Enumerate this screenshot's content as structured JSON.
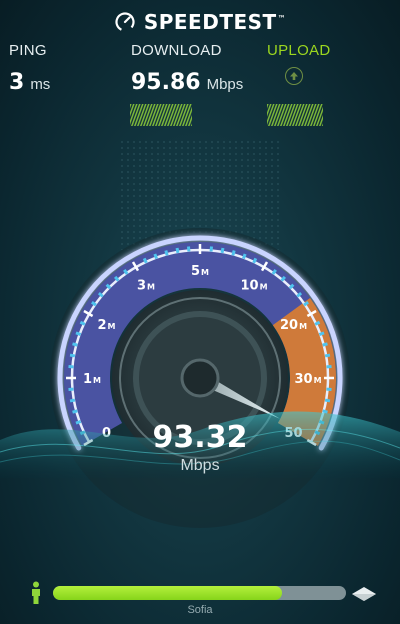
{
  "header": {
    "brand": "SPEEDTEST",
    "trademark": "™",
    "icon": "gauge-icon"
  },
  "ping": {
    "label": "PING",
    "value": "3",
    "unit": "ms"
  },
  "download": {
    "label": "DOWNLOAD",
    "value": "95.86",
    "unit": "Mbps"
  },
  "upload": {
    "label": "UPLOAD",
    "icon": "arrow-up-icon"
  },
  "gauge": {
    "current_value": "93.32",
    "current_unit": "Mbps",
    "ticks": [
      {
        "num": "0",
        "unit": ""
      },
      {
        "num": "1",
        "unit": "M"
      },
      {
        "num": "2",
        "unit": "M"
      },
      {
        "num": "3",
        "unit": "M"
      },
      {
        "num": "5",
        "unit": "M"
      },
      {
        "num": "10",
        "unit": "M"
      },
      {
        "num": "20",
        "unit": "M"
      },
      {
        "num": "30",
        "unit": "M"
      },
      {
        "num": "50",
        "unit": ""
      }
    ],
    "needle_tick_position": 8
  },
  "footer": {
    "server": "Sofia",
    "progress": 0.78,
    "left_icon": "person-icon",
    "right_icon": "server-icon"
  },
  "colors": {
    "accent_green": "#9bd61f",
    "gauge_blue": "#4e57a8",
    "gauge_orange": "#d77a36",
    "background": "#123640"
  }
}
